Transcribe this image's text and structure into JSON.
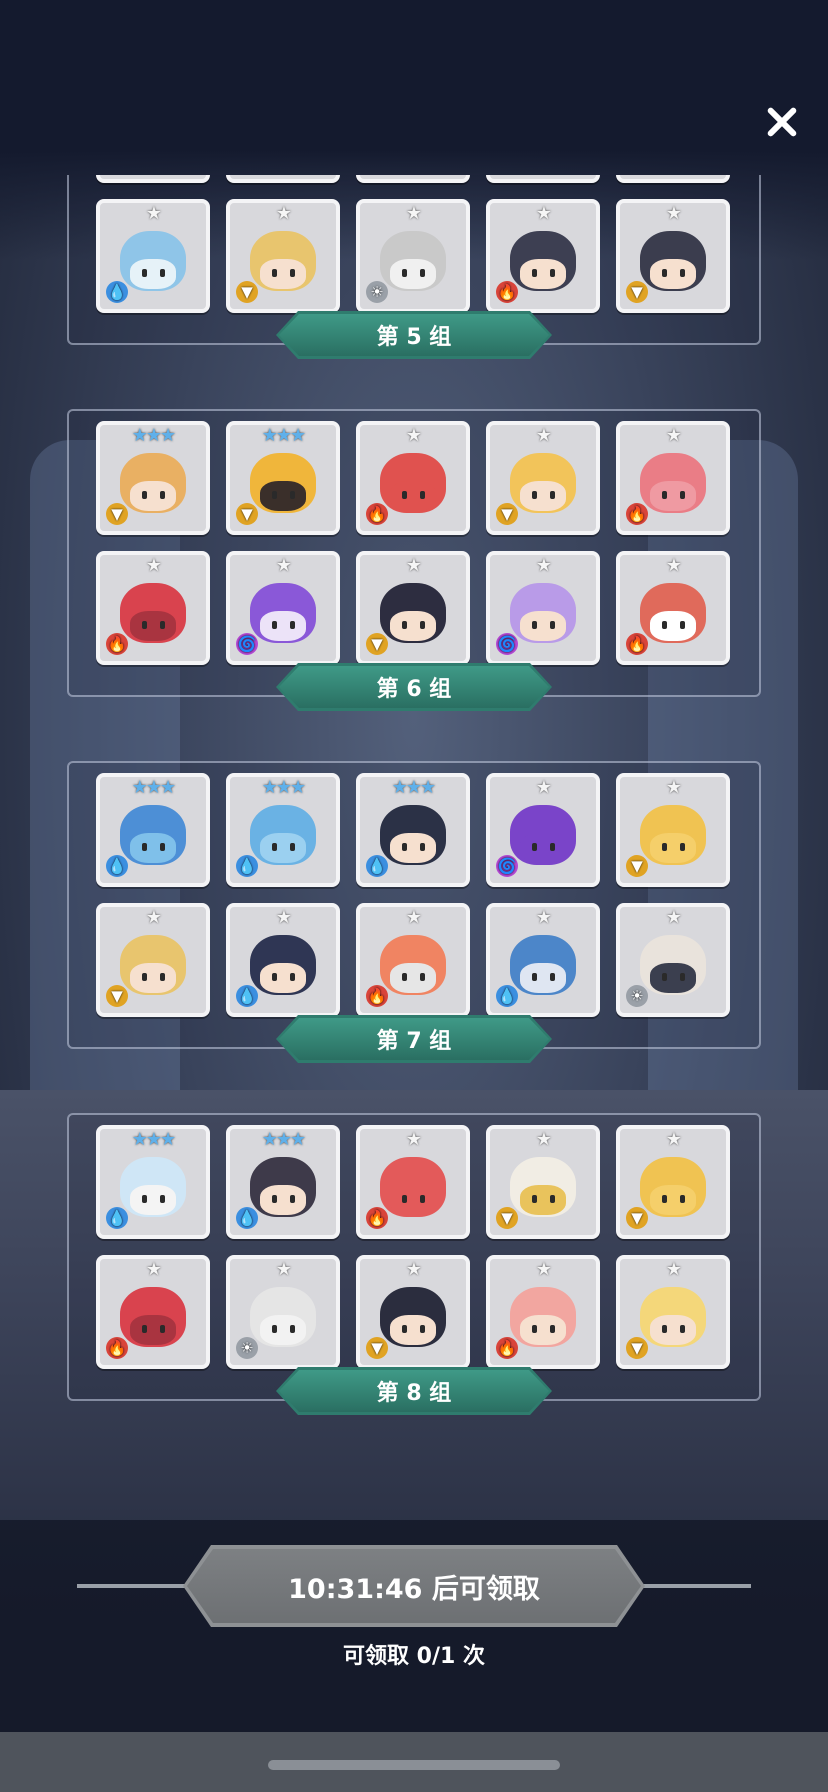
{
  "colors": {
    "panel_label_bg": "#2f7c6e",
    "claim_button": "#7d8083",
    "card_bg": "#d8d8dc",
    "star_white": "#f5f5f5",
    "star_blue": "#5fb0ea"
  },
  "icons": {
    "close": "close-icon",
    "elements": {
      "fire": "🔥",
      "water": "💧",
      "wind": "🌀",
      "light": "☀",
      "dark": "🌀",
      "earth": "▼"
    }
  },
  "groups": [
    {
      "label": "第 5 组",
      "heroes": [
        {
          "stars": "",
          "element": "fire",
          "hair": "#ea8a73",
          "skin": "#f6e0cf"
        },
        {
          "stars": "",
          "element": "fire",
          "hair": "#e57d73",
          "skin": "#f6e6dd"
        },
        {
          "stars": "",
          "element": "fire",
          "hair": "#e88a6b",
          "skin": "#f6e0cf"
        },
        {
          "stars": "",
          "element": "earth",
          "hair": "#e8c05a",
          "skin": "#f0d58a"
        },
        {
          "stars": "",
          "element": "fire",
          "hair": "#e97f79",
          "skin": "#ef8f8a"
        },
        {
          "stars": "★",
          "element": "water",
          "hair": "#8fc5e8",
          "skin": "#e6f2f8"
        },
        {
          "stars": "★",
          "element": "earth",
          "hair": "#e8c56e",
          "skin": "#f6e0cf"
        },
        {
          "stars": "★",
          "element": "light",
          "hair": "#c9c9c9",
          "skin": "#f0f0f0"
        },
        {
          "stars": "★",
          "element": "fire",
          "hair": "#3d3f52",
          "skin": "#f6e0cf"
        },
        {
          "stars": "★",
          "element": "earth",
          "hair": "#3b3d4e",
          "skin": "#f6e0cf"
        }
      ]
    },
    {
      "label": "第 6 组",
      "heroes": [
        {
          "stars": "★★★",
          "element": "earth",
          "hair": "#e9b063",
          "skin": "#f6e0cf"
        },
        {
          "stars": "★★★",
          "element": "earth",
          "hair": "#f0b63b",
          "skin": "#3a2f2a"
        },
        {
          "stars": "★",
          "element": "fire",
          "hair": "#e0524f",
          "skin": "#e0524f"
        },
        {
          "stars": "★",
          "element": "earth",
          "hair": "#f2c45a",
          "skin": "#f6e0cf"
        },
        {
          "stars": "★",
          "element": "fire",
          "hair": "#ea7d86",
          "skin": "#ef9aa2"
        },
        {
          "stars": "★",
          "element": "fire",
          "hair": "#d9434e",
          "skin": "#a93440"
        },
        {
          "stars": "★",
          "element": "dark",
          "hair": "#8a58d8",
          "skin": "#ece3f8"
        },
        {
          "stars": "★",
          "element": "earth",
          "hair": "#2d2d40",
          "skin": "#f6e0cf"
        },
        {
          "stars": "★",
          "element": "dark",
          "hair": "#b99be8",
          "skin": "#f6e0cf"
        },
        {
          "stars": "★",
          "element": "fire",
          "hair": "#e06a5b",
          "skin": "#ffffff"
        }
      ]
    },
    {
      "label": "第 7 组",
      "heroes": [
        {
          "stars": "★★★",
          "element": "water",
          "hair": "#4d8fd6",
          "skin": "#7fc0ea"
        },
        {
          "stars": "★★★",
          "element": "water",
          "hair": "#6ab2e4",
          "skin": "#9bd0f0"
        },
        {
          "stars": "★★★",
          "element": "water",
          "hair": "#2b3146",
          "skin": "#f6e0cf"
        },
        {
          "stars": "★",
          "element": "dark",
          "hair": "#7a44c9",
          "skin": "#7a44c9"
        },
        {
          "stars": "★",
          "element": "earth",
          "hair": "#f0c352",
          "skin": "#f5cf6a"
        },
        {
          "stars": "★",
          "element": "earth",
          "hair": "#e8c56e",
          "skin": "#f6e0cf"
        },
        {
          "stars": "★",
          "element": "water",
          "hair": "#2f3654",
          "skin": "#f6e0cf"
        },
        {
          "stars": "★",
          "element": "fire",
          "hair": "#f08462",
          "skin": "#e6e6e6"
        },
        {
          "stars": "★",
          "element": "water",
          "hair": "#4c86c9",
          "skin": "#dfe6f2"
        },
        {
          "stars": "★",
          "element": "light",
          "hair": "#e9e3dc",
          "skin": "#3b3f4f"
        }
      ]
    },
    {
      "label": "第 8 组",
      "heroes": [
        {
          "stars": "★★★",
          "element": "water",
          "hair": "#cfe6f6",
          "skin": "#f4f4f4"
        },
        {
          "stars": "★★★",
          "element": "water",
          "hair": "#3e3a4a",
          "skin": "#f6e0cf"
        },
        {
          "stars": "★",
          "element": "fire",
          "hair": "#e35a5a",
          "skin": "#e35a5a"
        },
        {
          "stars": "★",
          "element": "earth",
          "hair": "#f1ede4",
          "skin": "#e9c35c"
        },
        {
          "stars": "★",
          "element": "earth",
          "hair": "#f0c352",
          "skin": "#f5cf6a"
        },
        {
          "stars": "★",
          "element": "fire",
          "hair": "#d9434e",
          "skin": "#a93440"
        },
        {
          "stars": "★",
          "element": "light",
          "hair": "#e5e5e5",
          "skin": "#f2f2f2"
        },
        {
          "stars": "★",
          "element": "earth",
          "hair": "#2b2d3e",
          "skin": "#f6e0cf"
        },
        {
          "stars": "★",
          "element": "fire",
          "hair": "#f2a6a0",
          "skin": "#f6e0cf"
        },
        {
          "stars": "★",
          "element": "earth",
          "hair": "#f4d77a",
          "skin": "#f6e0cf"
        }
      ]
    }
  ],
  "claim": {
    "button_label": "10:31:46 后可领取",
    "count_label": "可领取 0/1 次"
  }
}
